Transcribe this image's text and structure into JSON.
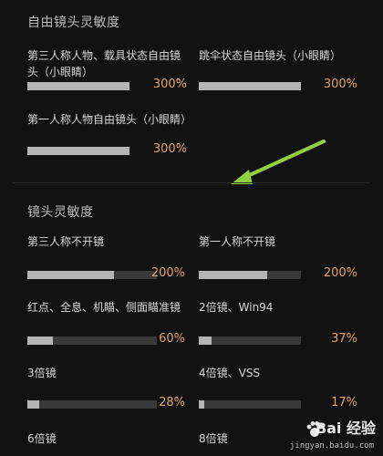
{
  "sections": [
    {
      "title": "自由镜头灵敏度",
      "items": [
        {
          "label": "第三人称人物、载具状态自由镜头（小眼睛）",
          "value": "300%",
          "level": 300
        },
        {
          "label": "跳伞状态自由镜头（小眼睛）",
          "value": "300%",
          "level": 300
        },
        {
          "label": "第一人称人物自由镜头（小眼睛）",
          "value": "300%",
          "level": 300
        }
      ]
    },
    {
      "title": "镜头灵敏度",
      "items": [
        {
          "label": "第三人称不开镜",
          "value": "200%",
          "level": 200
        },
        {
          "label": "第一人称不开镜",
          "value": "200%",
          "level": 200
        },
        {
          "label": "红点、全息、机瞄、侧面瞄准镜",
          "value": "60%",
          "level": 60
        },
        {
          "label": "2倍镜、Win94",
          "value": "37%",
          "level": 37
        },
        {
          "label": "3倍镜",
          "value": "28%",
          "level": 28
        },
        {
          "label": "4倍镜、VSS",
          "value": "17%",
          "level": 17
        },
        {
          "label": "6倍镜",
          "value": "",
          "level": null
        },
        {
          "label": "8倍镜",
          "value": "",
          "level": null
        }
      ]
    }
  ],
  "slider_max": 300,
  "colors": {
    "background": "#121212",
    "track": "#3a3a3a",
    "fill": "#b5b5b5",
    "value_text": "#e3a36b",
    "arrow": "#8fd13f"
  },
  "watermark": {
    "brand": "Bai 经验",
    "url": "jingyan.baidu.com",
    "icon": "paw-icon"
  }
}
